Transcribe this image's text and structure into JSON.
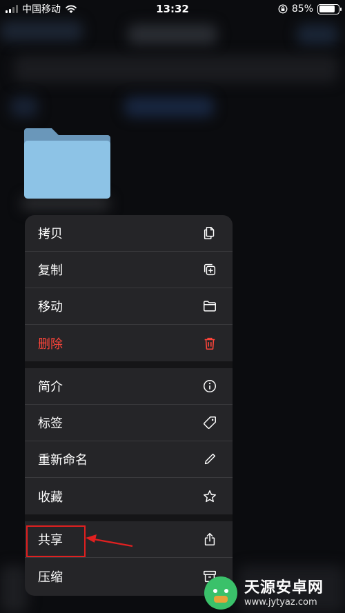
{
  "status_bar": {
    "carrier": "中国移动",
    "time": "13:32",
    "battery": "85%",
    "battery_level": 0.85
  },
  "menu": {
    "groups": [
      [
        {
          "label": "拷贝",
          "icon": "copy-icon"
        },
        {
          "label": "复制",
          "icon": "duplicate-icon"
        },
        {
          "label": "移动",
          "icon": "folder-icon"
        },
        {
          "label": "删除",
          "icon": "trash-icon",
          "destructive": true
        }
      ],
      [
        {
          "label": "简介",
          "icon": "info-icon"
        },
        {
          "label": "标签",
          "icon": "tag-icon"
        },
        {
          "label": "重新命名",
          "icon": "pencil-icon"
        },
        {
          "label": "收藏",
          "icon": "star-icon"
        }
      ],
      [
        {
          "label": "共享",
          "icon": "share-icon"
        },
        {
          "label": "压缩",
          "icon": "archive-icon"
        }
      ]
    ]
  },
  "watermark": {
    "name": "天源安卓网",
    "url": "www.jytyaz.com"
  },
  "colors": {
    "destructive": "#ff453a",
    "annotation": "#e02020",
    "folder": "#8dc3e6"
  }
}
